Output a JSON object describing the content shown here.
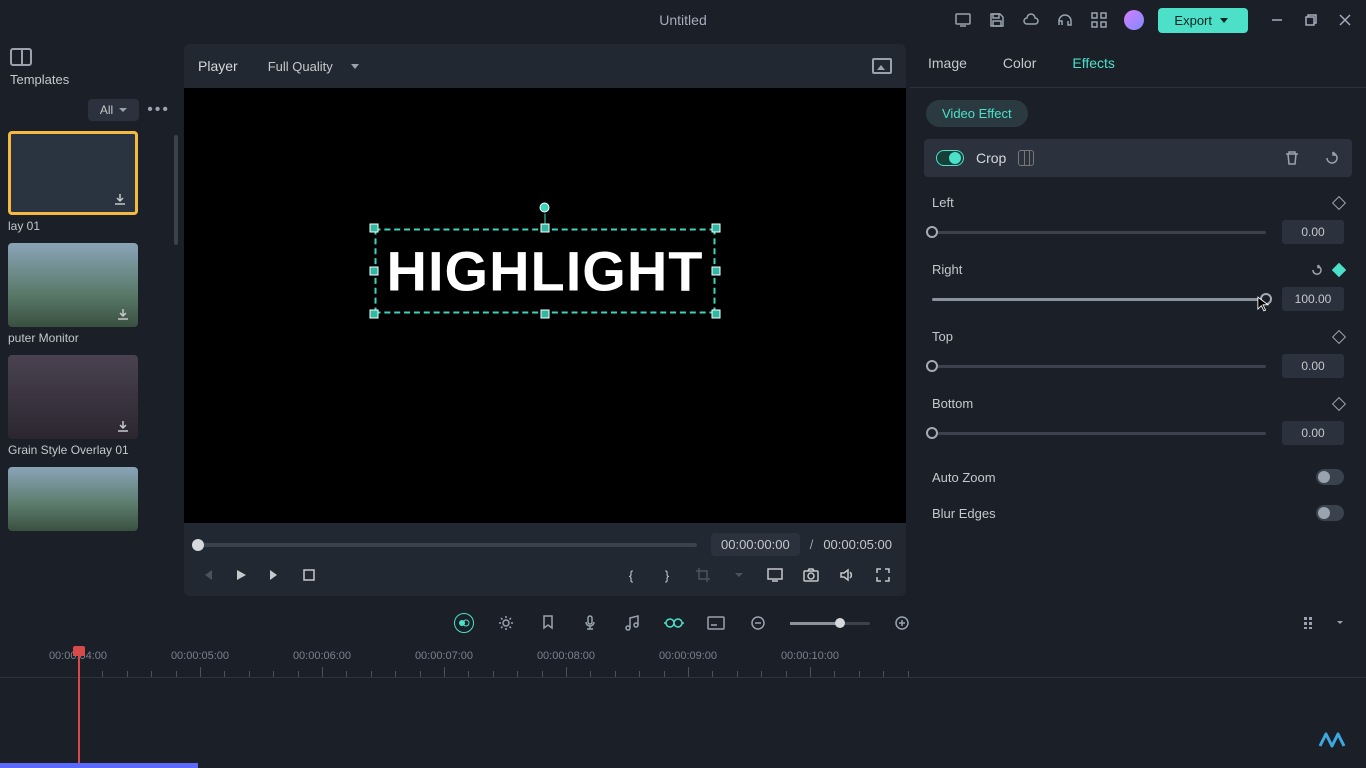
{
  "titlebar": {
    "title": "Untitled",
    "export_label": "Export"
  },
  "left": {
    "templates_label": "Templates",
    "filter_label": "All",
    "items": [
      {
        "caption": "lay 01"
      },
      {
        "caption": "puter Monitor"
      },
      {
        "caption": "Grain Style Overlay 01"
      },
      {
        "caption": ""
      }
    ]
  },
  "player": {
    "header_label": "Player",
    "quality_label": "Full Quality",
    "canvas_text": "HIGHLIGHT",
    "time_current": "00:00:00:00",
    "time_total": "00:00:05:00"
  },
  "inspector": {
    "tabs": {
      "image": "Image",
      "color": "Color",
      "effects": "Effects"
    },
    "chip": "Video Effect",
    "crop_label": "Crop",
    "props": {
      "left": {
        "label": "Left",
        "value": "0.00",
        "pct": 0
      },
      "right": {
        "label": "Right",
        "value": "100.00",
        "pct": 100
      },
      "top": {
        "label": "Top",
        "value": "0.00",
        "pct": 0
      },
      "bottom": {
        "label": "Bottom",
        "value": "0.00",
        "pct": 0
      }
    },
    "auto_zoom_label": "Auto Zoom",
    "blur_edges_label": "Blur Edges"
  },
  "timeline": {
    "marks": [
      "00:00:04:00",
      "00:00:05:00",
      "00:00:06:00",
      "00:00:07:00",
      "00:00:08:00",
      "00:00:09:00",
      "00:00:10:00"
    ]
  }
}
